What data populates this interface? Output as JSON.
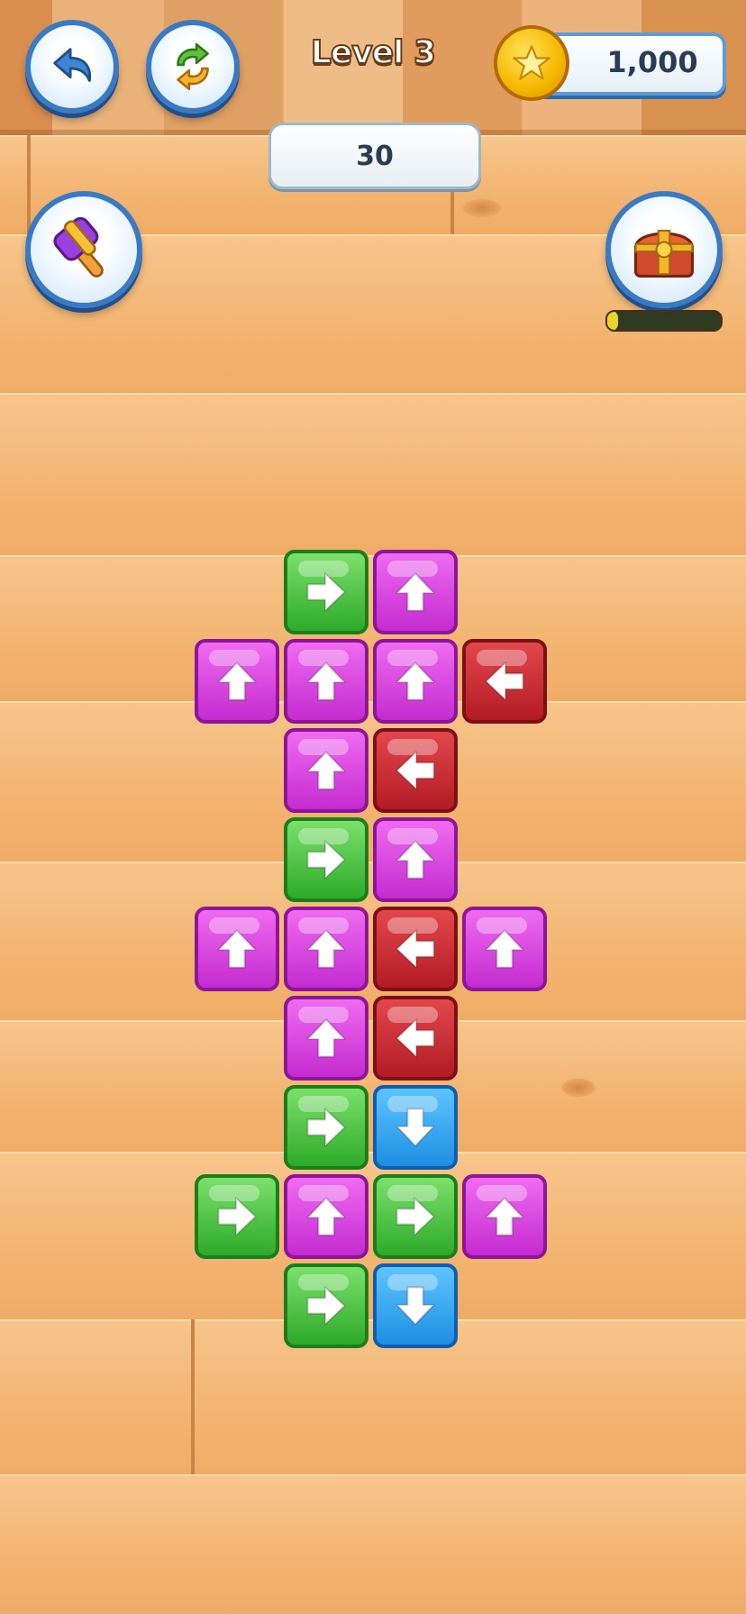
{
  "hud": {
    "level_label": "Level 3",
    "coins": "1,000",
    "moves": "30",
    "progress_fraction": 0.08,
    "colors": {
      "accent_blue": "#3a7ac4",
      "coin_gold": "#f5b700",
      "progress_green": "#5b7f1c"
    },
    "icons": {
      "back": "back-arrow-icon",
      "restart": "refresh-icon",
      "hammer": "hammer-icon",
      "chest": "treasure-chest-icon",
      "coin": "star-coin-icon"
    }
  },
  "board": {
    "tiles": [
      {
        "row": 0,
        "col": 1,
        "color": "green",
        "dir": "right"
      },
      {
        "row": 0,
        "col": 2,
        "color": "pink",
        "dir": "up"
      },
      {
        "row": 1,
        "col": 0,
        "color": "pink",
        "dir": "up"
      },
      {
        "row": 1,
        "col": 1,
        "color": "pink",
        "dir": "up"
      },
      {
        "row": 1,
        "col": 2,
        "color": "pink",
        "dir": "up"
      },
      {
        "row": 1,
        "col": 3,
        "color": "red",
        "dir": "left"
      },
      {
        "row": 2,
        "col": 1,
        "color": "pink",
        "dir": "up"
      },
      {
        "row": 2,
        "col": 2,
        "color": "red",
        "dir": "left"
      },
      {
        "row": 3,
        "col": 1,
        "color": "green",
        "dir": "right"
      },
      {
        "row": 3,
        "col": 2,
        "color": "pink",
        "dir": "up"
      },
      {
        "row": 4,
        "col": 0,
        "color": "pink",
        "dir": "up"
      },
      {
        "row": 4,
        "col": 1,
        "color": "pink",
        "dir": "up"
      },
      {
        "row": 4,
        "col": 2,
        "color": "red",
        "dir": "left"
      },
      {
        "row": 4,
        "col": 3,
        "color": "pink",
        "dir": "up"
      },
      {
        "row": 5,
        "col": 1,
        "color": "pink",
        "dir": "up"
      },
      {
        "row": 5,
        "col": 2,
        "color": "red",
        "dir": "left"
      },
      {
        "row": 6,
        "col": 1,
        "color": "green",
        "dir": "right"
      },
      {
        "row": 6,
        "col": 2,
        "color": "blue",
        "dir": "down"
      },
      {
        "row": 7,
        "col": 0,
        "color": "green",
        "dir": "right"
      },
      {
        "row": 7,
        "col": 1,
        "color": "pink",
        "dir": "up"
      },
      {
        "row": 7,
        "col": 2,
        "color": "green",
        "dir": "right"
      },
      {
        "row": 7,
        "col": 3,
        "color": "pink",
        "dir": "up"
      },
      {
        "row": 8,
        "col": 1,
        "color": "green",
        "dir": "right"
      },
      {
        "row": 8,
        "col": 2,
        "color": "blue",
        "dir": "down"
      }
    ]
  }
}
